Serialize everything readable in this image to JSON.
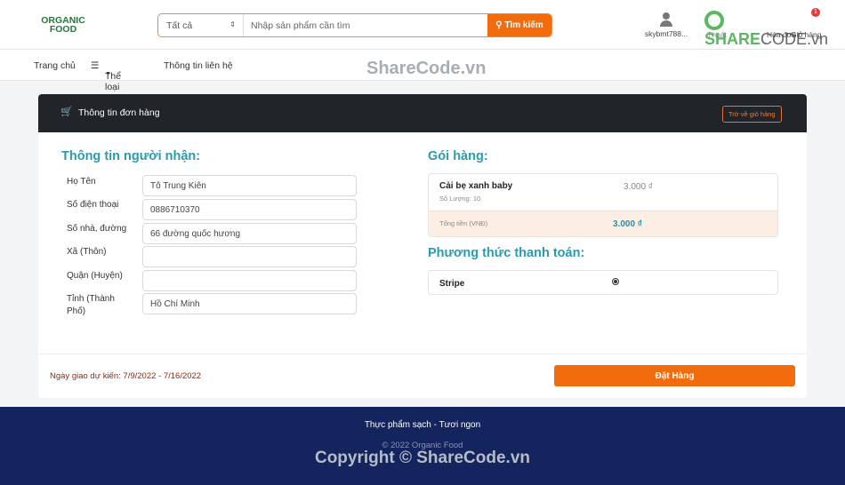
{
  "header": {
    "logo": "ORGANIC FOOD",
    "category": "Tất cả",
    "search_placeholder": "Nhập sản phẩm cần tìm",
    "search_button": "Tìm kiếm",
    "user": "skybmt788...",
    "logout": "Thoát",
    "invoices": "Hóa đơn",
    "cart": "Giỏ hàng",
    "cart_count": "1"
  },
  "nav": {
    "home": "Trang chủ",
    "categories": "Thể loại",
    "contact": "Thông tin liên hệ"
  },
  "card": {
    "title": "Thông tin đơn hàng",
    "back_button": "Trở về giỏ hàng"
  },
  "recipient": {
    "heading": "Thông tin người nhận:",
    "fields": [
      {
        "label": "Họ Tên",
        "value": "Tô Trung Kiên"
      },
      {
        "label": "Số điện thoại",
        "value": "0886710370"
      },
      {
        "label": "Số nhà, đường",
        "value": "66 đường quốc hương"
      },
      {
        "label": "Xã (Thôn)",
        "value": ""
      },
      {
        "label": "Quận (Huyện)",
        "value": ""
      },
      {
        "label": "Tỉnh (Thành Phố)",
        "value": "Hồ Chí Minh"
      }
    ]
  },
  "package": {
    "heading": "Gói hàng:",
    "item_name": "Cải bẹ xanh baby",
    "item_qty": "Số Lượng: 10",
    "item_price": "3.000 ₫",
    "total_label": "Tổng tiền (VNĐ)",
    "total_value": "3.000 ₫"
  },
  "payment": {
    "heading": "Phương thức thanh toán:",
    "method": "Stripe",
    "selected": true
  },
  "order": {
    "delivery": "Ngày giao dự kiến: 7/9/2022 - 7/16/2022",
    "button": "Đặt Hàng"
  },
  "footer": {
    "slogan": "Thực phẩm sạch - Tươi ngon",
    "copyright": "© 2022 Organic Food"
  },
  "watermarks": {
    "top": "ShareCode.vn",
    "bottom": "Copyright © ShareCode.vn",
    "logo": "SHARECODE.vn"
  },
  "colors": {
    "accent": "#f26c0d",
    "heading": "#2a9bb0",
    "footer": "#14245e"
  }
}
